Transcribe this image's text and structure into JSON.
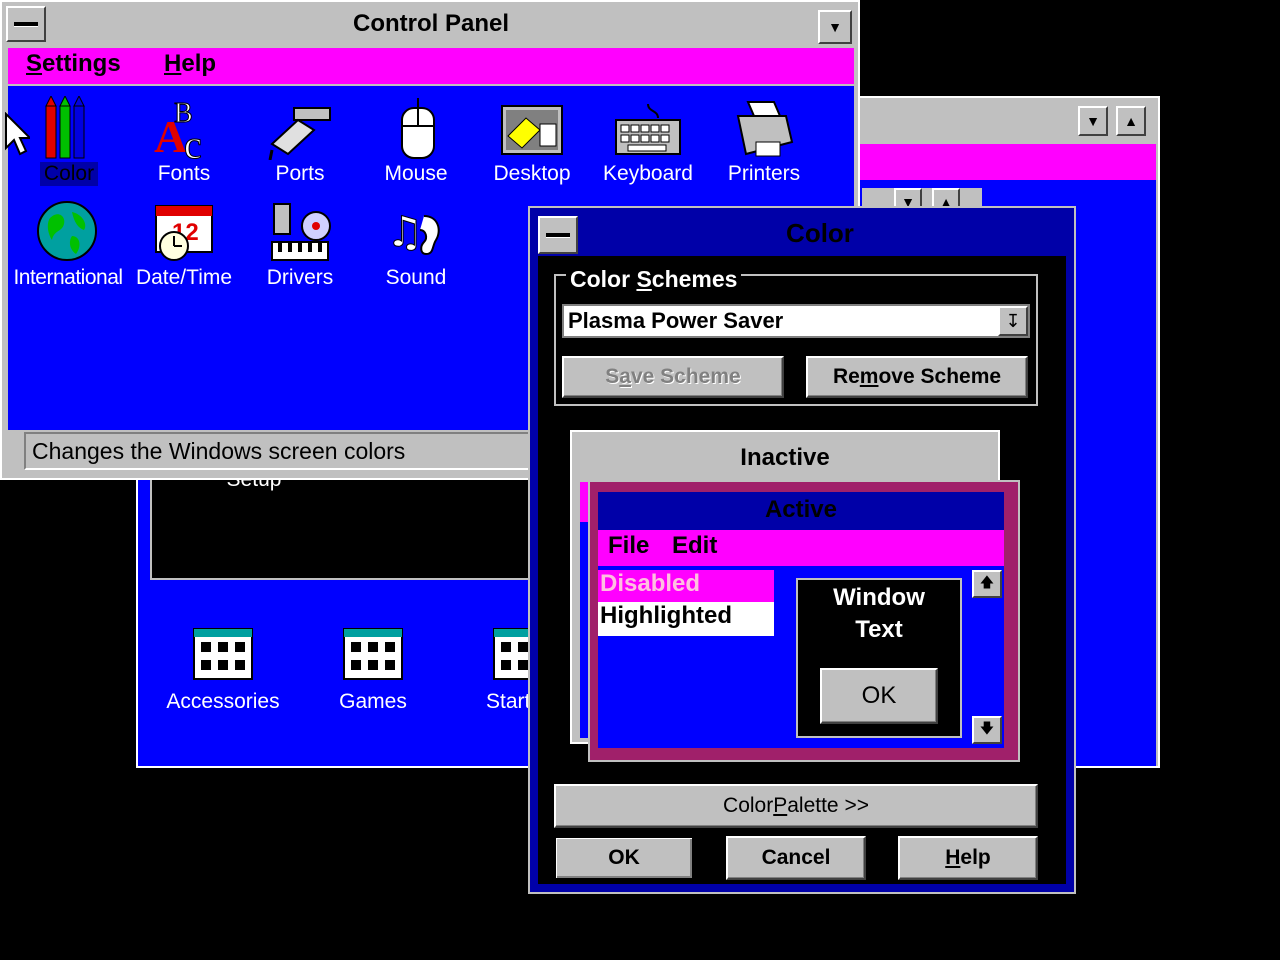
{
  "control_panel": {
    "title": "Control Panel",
    "menu": [
      {
        "label_pre": "",
        "key": "S",
        "label_post": "ettings"
      },
      {
        "label_pre": "",
        "key": "H",
        "label_post": "elp"
      }
    ],
    "icons": [
      "Color",
      "Fonts",
      "Ports",
      "Mouse",
      "Desktop",
      "Keyboard",
      "Printers",
      "International",
      "Date/Time",
      "Drivers",
      "Sound"
    ],
    "status": "Changes the Windows screen colors"
  },
  "program_manager": {
    "partial_label": "Setup",
    "groups": [
      "Accessories",
      "Games",
      "Start"
    ]
  },
  "color_dialog": {
    "title": "Color",
    "schemes_label_pre": "Color ",
    "schemes_label_key": "S",
    "schemes_label_post": "chemes",
    "scheme_value": "Plasma Power Saver",
    "save_scheme": {
      "pre": "S",
      "key": "a",
      "post": "ve Scheme"
    },
    "remove_scheme": {
      "pre": "Re",
      "key": "m",
      "post": "ove Scheme"
    },
    "preview": {
      "inactive": "Inactive",
      "active": "Active",
      "menu_file": "File",
      "menu_edit": "Edit",
      "disabled": "Disabled",
      "highlighted": "Highlighted",
      "window_text_1": "Window",
      "window_text_2": "Text",
      "ok": "OK"
    },
    "palette": {
      "pre": "Color ",
      "key": "P",
      "post": "alette >>"
    },
    "ok": "OK",
    "cancel": "Cancel",
    "help": {
      "pre": "",
      "key": "H",
      "post": "elp"
    }
  },
  "colors": {
    "desktop": "#000000",
    "window_bg": "#0000ff",
    "menu_bar": "#ff00ff",
    "active_title": "#0000a8",
    "frame": "#c0c0c0",
    "highlight": "#ffffff",
    "active_border": "#a0206a"
  }
}
